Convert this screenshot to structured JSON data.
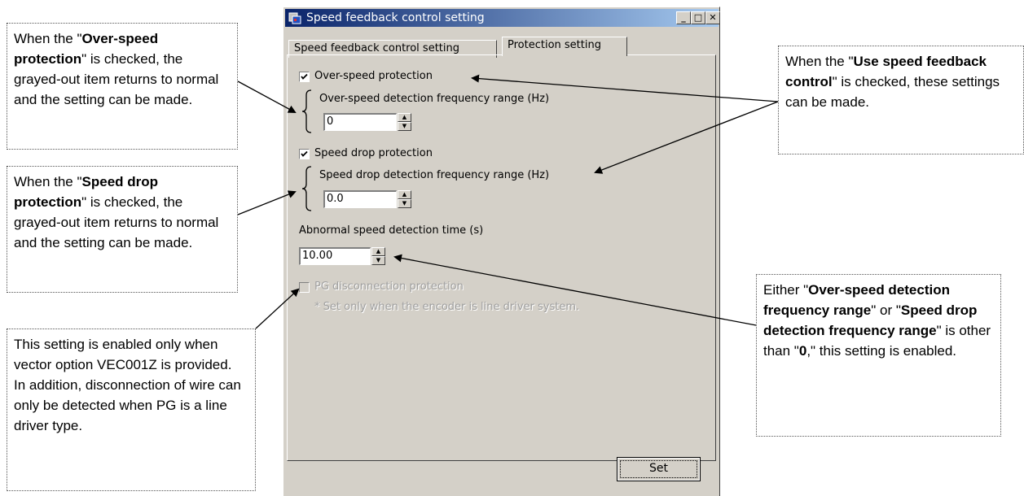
{
  "window": {
    "title": "Speed feedback control setting",
    "controls": {
      "minimize": "_",
      "maximize": "□",
      "close": "✕"
    },
    "tabs": [
      "Speed feedback control setting",
      "Protection setting"
    ],
    "active_tab": "Protection setting"
  },
  "protection": {
    "over_speed": {
      "label": "Over-speed protection",
      "checked": true
    },
    "over_speed_range": {
      "label": "Over-speed detection frequency range (Hz)",
      "value": "0"
    },
    "speed_drop": {
      "label": "Speed drop protection",
      "checked": true
    },
    "speed_drop_range": {
      "label": "Speed drop detection frequency range (Hz)",
      "value": "0.0"
    },
    "abnormal_time": {
      "label": "Abnormal speed detection time (s)",
      "value": "10.00"
    },
    "pg_disconnect": {
      "label": "PG disconnection protection",
      "checked": false,
      "enabled": false
    },
    "pg_note": "* Set only when the encoder is line driver system."
  },
  "set_button": "Set",
  "callouts": {
    "over_speed": {
      "p1": "When the \"",
      "b1": "Over-speed protection",
      "p2": "\" is checked, the grayed-out item returns to normal and the setting can be made."
    },
    "speed_drop": {
      "p1": "When the \"",
      "b1": "Speed drop protection",
      "p2": "\" is checked, the grayed-out item returns to normal and the setting can be made."
    },
    "vector_option": {
      "line1": "This setting is enabled only when vector option VEC001Z is provided.",
      "line2": "In addition, disconnection of wire can only be detected when PG is a line driver type."
    },
    "use_speed": {
      "p1": "When the \"",
      "b1": "Use speed feedback control",
      "p2": "\" is checked, these settings can be made."
    },
    "either": {
      "p1": "Either \"",
      "b1": "Over-speed detection frequency range",
      "p2": "\" or \"",
      "b2": "Speed drop detection frequency range",
      "p3": "\" is other than \"",
      "b3": "0",
      "p4": ",\" this setting is enabled."
    }
  }
}
